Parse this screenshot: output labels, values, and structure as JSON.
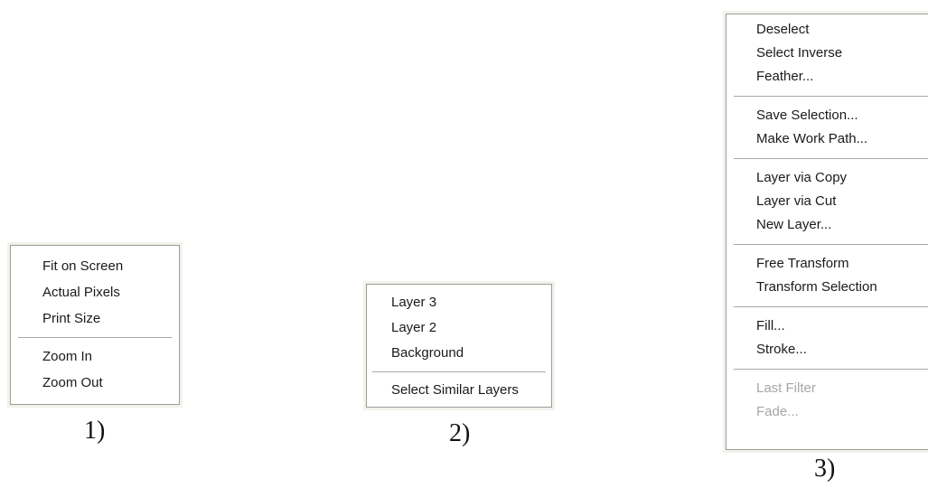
{
  "menus": [
    {
      "caption": "1)",
      "groups": [
        [
          "Fit on Screen",
          "Actual Pixels",
          "Print Size"
        ],
        [
          "Zoom In",
          "Zoom Out"
        ]
      ]
    },
    {
      "caption": "2)",
      "groups": [
        [
          "Layer 3",
          "Layer 2",
          "Background"
        ],
        [
          "Select Similar Layers"
        ]
      ]
    },
    {
      "caption": "3)",
      "groups": [
        [
          "Deselect",
          "Select Inverse",
          "Feather..."
        ],
        [
          "Save Selection...",
          "Make Work Path..."
        ],
        [
          "Layer via Copy",
          "Layer via Cut",
          "New Layer..."
        ],
        [
          "Free Transform",
          "Transform Selection"
        ],
        [
          "Fill...",
          "Stroke..."
        ],
        [
          "Last Filter",
          "Fade..."
        ]
      ],
      "disabled": [
        "Last Filter",
        "Fade..."
      ]
    }
  ],
  "colors": {
    "menu_background": "#ffffff",
    "menu_border": "#9e9c94",
    "separator": "#a8a8a8",
    "disabled_text": "#a6a6a6"
  }
}
